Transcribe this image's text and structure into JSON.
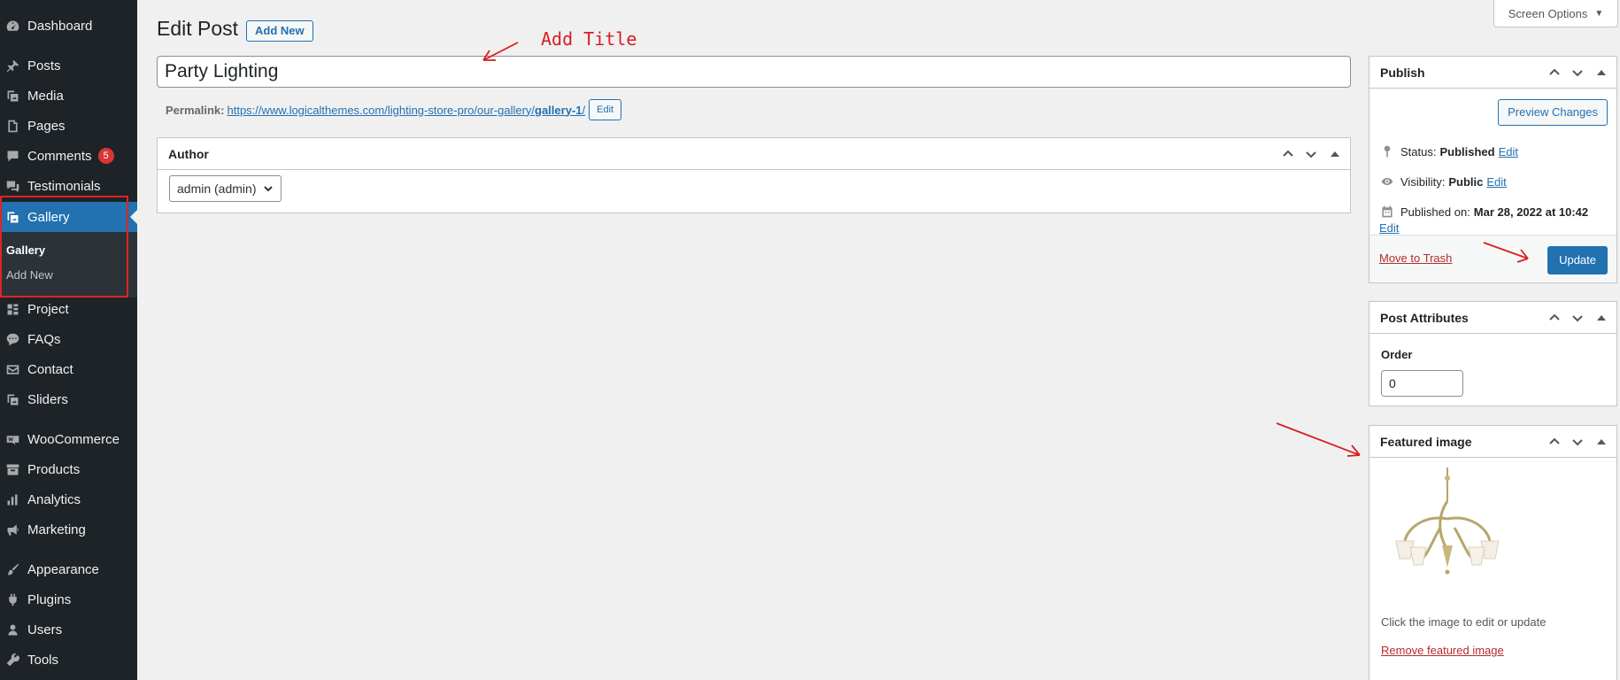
{
  "sidebar": {
    "items": [
      {
        "label": "Dashboard",
        "icon": "dashboard-icon"
      },
      {
        "label": "Posts",
        "icon": "pin-icon"
      },
      {
        "label": "Media",
        "icon": "media-icon"
      },
      {
        "label": "Pages",
        "icon": "pages-icon"
      },
      {
        "label": "Comments",
        "icon": "comment-icon",
        "badge": "5"
      },
      {
        "label": "Testimonials",
        "icon": "testimonial-icon"
      },
      {
        "label": "Gallery",
        "icon": "gallery-icon",
        "active": true
      },
      {
        "label": "Project",
        "icon": "portfolio-icon"
      },
      {
        "label": "FAQs",
        "icon": "faq-icon"
      },
      {
        "label": "Contact",
        "icon": "mail-icon"
      },
      {
        "label": "Sliders",
        "icon": "slider-icon"
      },
      {
        "label": "WooCommerce",
        "icon": "woo-icon"
      },
      {
        "label": "Products",
        "icon": "archive-icon"
      },
      {
        "label": "Analytics",
        "icon": "chart-icon"
      },
      {
        "label": "Marketing",
        "icon": "megaphone-icon"
      },
      {
        "label": "Appearance",
        "icon": "brush-icon"
      },
      {
        "label": "Plugins",
        "icon": "plugin-icon"
      },
      {
        "label": "Users",
        "icon": "users-icon"
      },
      {
        "label": "Tools",
        "icon": "wrench-icon"
      }
    ],
    "submenu": {
      "current": "Gallery",
      "add_new": "Add New"
    }
  },
  "header": {
    "title": "Edit Post",
    "add_new": "Add New",
    "screen_options": "Screen Options"
  },
  "post": {
    "title": "Party Lighting",
    "permalink_label": "Permalink:",
    "permalink_base": "https://www.logicalthemes.com/lighting-store-pro/our-gallery/",
    "permalink_slug": "gallery-1",
    "permalink_trail": "/",
    "permalink_edit": "Edit"
  },
  "author_box": {
    "title": "Author",
    "selected": "admin (admin)"
  },
  "publish_box": {
    "title": "Publish",
    "preview": "Preview Changes",
    "status_label": "Status:",
    "status_value": "Published",
    "visibility_label": "Visibility:",
    "visibility_value": "Public",
    "published_label": "Published on:",
    "published_value": "Mar 28, 2022 at 10:42",
    "edit": "Edit",
    "trash": "Move to Trash",
    "update": "Update"
  },
  "attributes_box": {
    "title": "Post Attributes",
    "order_label": "Order",
    "order_value": "0"
  },
  "featured_box": {
    "title": "Featured image",
    "help": "Click the image to edit or update",
    "remove": "Remove featured image"
  },
  "annotations": {
    "add_title": "Add Title",
    "color": "#d81e1e"
  },
  "colors": {
    "sidebar_bg": "#1d2327",
    "accent": "#2271b1",
    "danger": "#b32d2e"
  }
}
